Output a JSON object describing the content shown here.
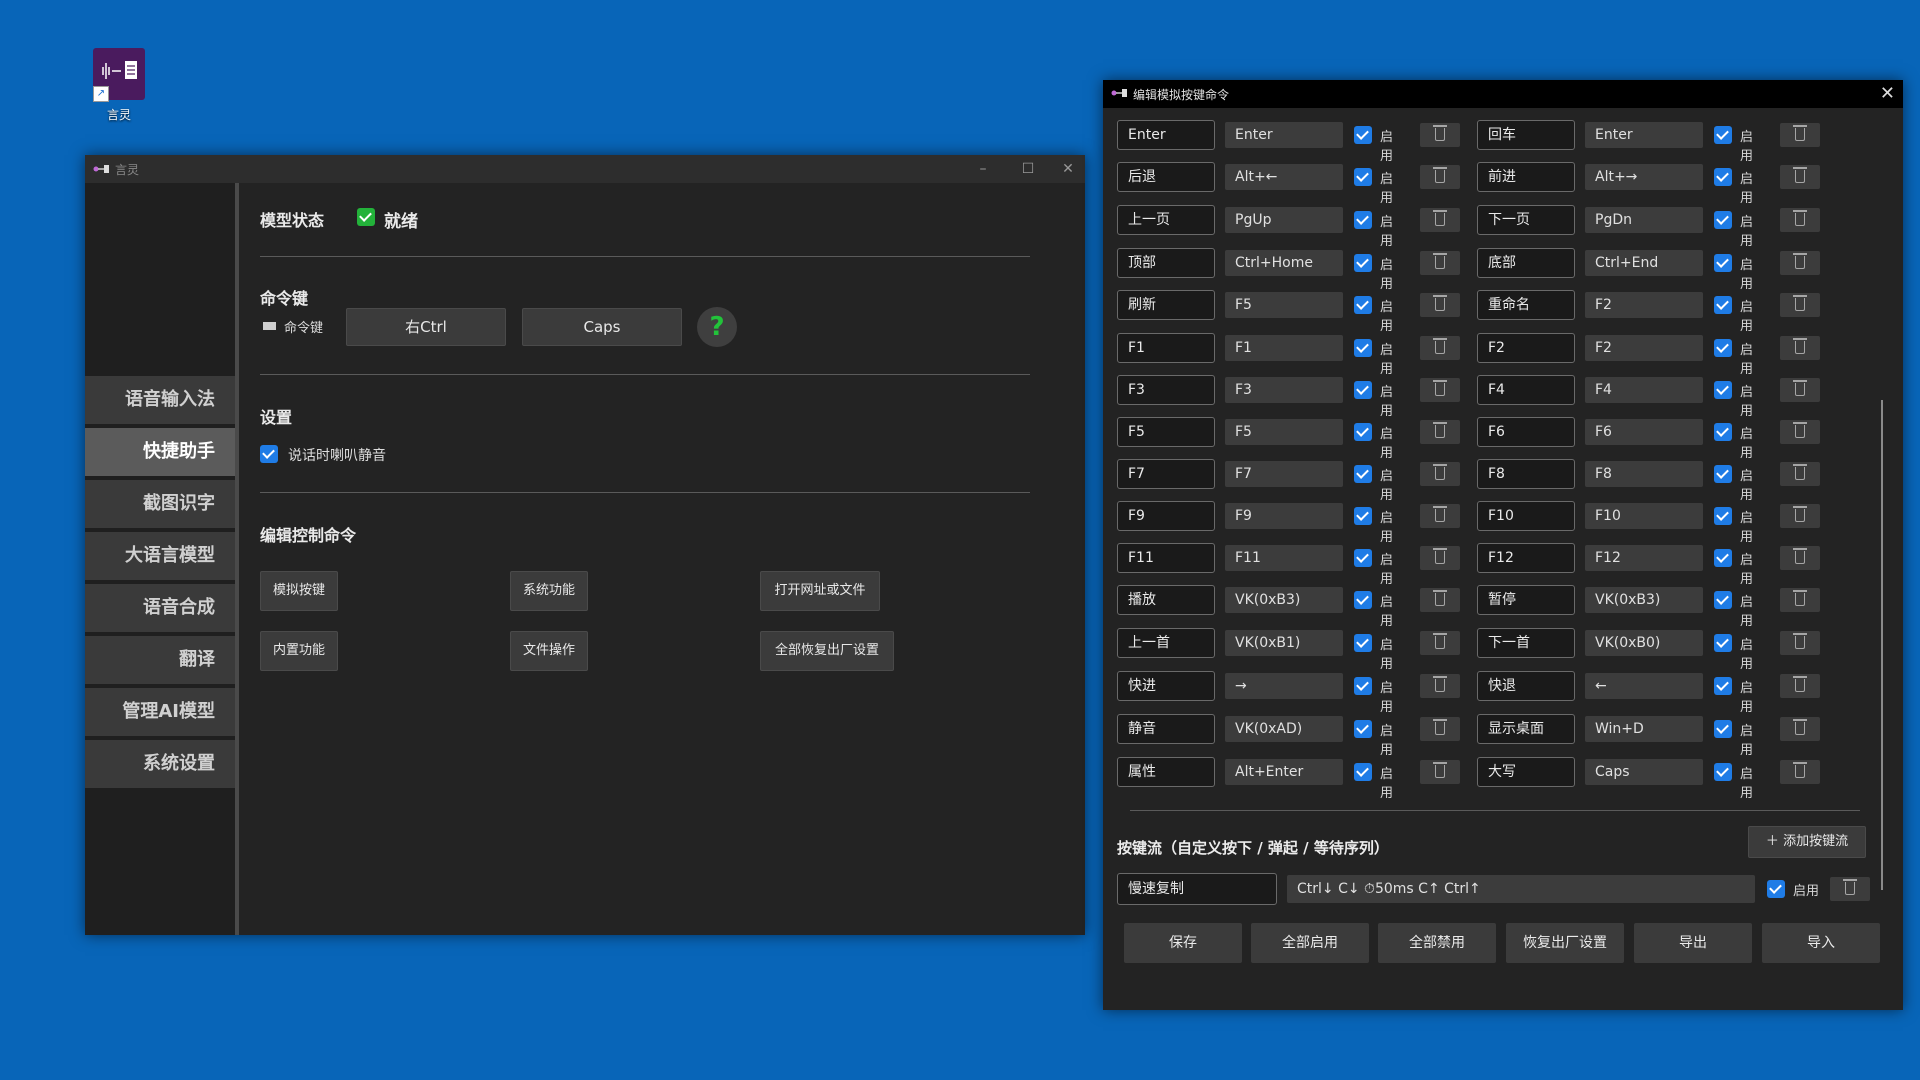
{
  "desktop": {
    "icon_label": "言灵"
  },
  "main_window": {
    "title": "言灵",
    "controls": {
      "minimize": "–",
      "maximize": "☐",
      "close": "✕"
    },
    "sidebar": [
      {
        "label": "语音输入法",
        "active": false
      },
      {
        "label": "快捷助手",
        "active": true
      },
      {
        "label": "截图识字",
        "active": false
      },
      {
        "label": "大语言模型",
        "active": false
      },
      {
        "label": "语音合成",
        "active": false
      },
      {
        "label": "翻译",
        "active": false
      },
      {
        "label": "管理AI模型",
        "active": false
      },
      {
        "label": "系统设置",
        "active": false
      }
    ],
    "model_status": {
      "heading": "模型状态",
      "value": "就绪"
    },
    "command_key": {
      "heading": "命令键",
      "label": "命令键",
      "button1": "右Ctrl",
      "button2": "Caps",
      "help": "?"
    },
    "settings": {
      "heading": "设置",
      "mute_label": "说话时喇叭静音"
    },
    "edit_commands": {
      "heading": "编辑控制命令",
      "buttons": [
        "模拟按键",
        "系统功能",
        "打开网址或文件",
        "内置功能",
        "文件操作",
        "全部恢复出厂设置"
      ]
    }
  },
  "editor_window": {
    "title": "编辑模拟按键命令",
    "close": "✕",
    "enable_label": "启用",
    "rows": [
      [
        {
          "name": "Enter",
          "key": "Enter"
        },
        {
          "name": "回车",
          "key": "Enter"
        }
      ],
      [
        {
          "name": "后退",
          "key": "Alt+←"
        },
        {
          "name": "前进",
          "key": "Alt+→"
        }
      ],
      [
        {
          "name": "上一页",
          "key": "PgUp"
        },
        {
          "name": "下一页",
          "key": "PgDn"
        }
      ],
      [
        {
          "name": "顶部",
          "key": "Ctrl+Home"
        },
        {
          "name": "底部",
          "key": "Ctrl+End"
        }
      ],
      [
        {
          "name": "刷新",
          "key": "F5"
        },
        {
          "name": "重命名",
          "key": "F2"
        }
      ],
      [
        {
          "name": "F1",
          "key": "F1"
        },
        {
          "name": "F2",
          "key": "F2"
        }
      ],
      [
        {
          "name": "F3",
          "key": "F3"
        },
        {
          "name": "F4",
          "key": "F4"
        }
      ],
      [
        {
          "name": "F5",
          "key": "F5"
        },
        {
          "name": "F6",
          "key": "F6"
        }
      ],
      [
        {
          "name": "F7",
          "key": "F7"
        },
        {
          "name": "F8",
          "key": "F8"
        }
      ],
      [
        {
          "name": "F9",
          "key": "F9"
        },
        {
          "name": "F10",
          "key": "F10"
        }
      ],
      [
        {
          "name": "F11",
          "key": "F11"
        },
        {
          "name": "F12",
          "key": "F12"
        }
      ],
      [
        {
          "name": "播放",
          "key": "VK(0xB3)"
        },
        {
          "name": "暂停",
          "key": "VK(0xB3)"
        }
      ],
      [
        {
          "name": "上一首",
          "key": "VK(0xB1)"
        },
        {
          "name": "下一首",
          "key": "VK(0xB0)"
        }
      ],
      [
        {
          "name": "快进",
          "key": "→"
        },
        {
          "name": "快退",
          "key": "←"
        }
      ],
      [
        {
          "name": "静音",
          "key": "VK(0xAD)"
        },
        {
          "name": "显示桌面",
          "key": "Win+D"
        }
      ],
      [
        {
          "name": "属性",
          "key": "Alt+Enter"
        },
        {
          "name": "大写",
          "key": "Caps"
        }
      ]
    ],
    "key_flow": {
      "heading": "按键流（自定义按下 / 弹起 / 等待序列）",
      "add_button": "添加按键流",
      "name": "慢速复制",
      "sequence": "Ctrl↓ C↓ ⏱50ms C↑ Ctrl↑",
      "enable_label": "启用"
    },
    "bottom_buttons": [
      "保存",
      "全部启用",
      "全部禁用",
      "恢复出厂设置",
      "导出",
      "导入"
    ]
  }
}
